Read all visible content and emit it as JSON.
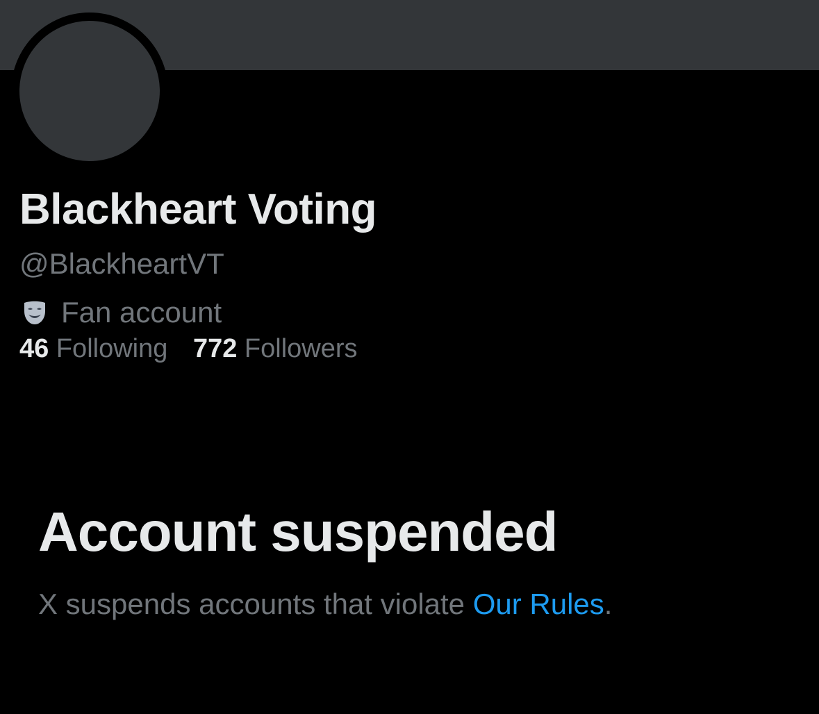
{
  "profile": {
    "display_name": "Blackheart Voting",
    "handle": "@BlackheartVT",
    "label": {
      "icon": "theater-mask-icon",
      "text": "Fan account"
    },
    "stats": {
      "following_count": "46",
      "following_label": "Following",
      "followers_count": "772",
      "followers_label": "Followers"
    }
  },
  "suspension": {
    "title": "Account suspended",
    "description_prefix": "X suspends accounts that violate ",
    "rules_link": "Our Rules",
    "description_suffix": "."
  },
  "colors": {
    "background": "#000000",
    "banner": "#333639",
    "primary_text": "#e7e9ea",
    "secondary_text": "#71767b",
    "link": "#1d9bf0"
  }
}
